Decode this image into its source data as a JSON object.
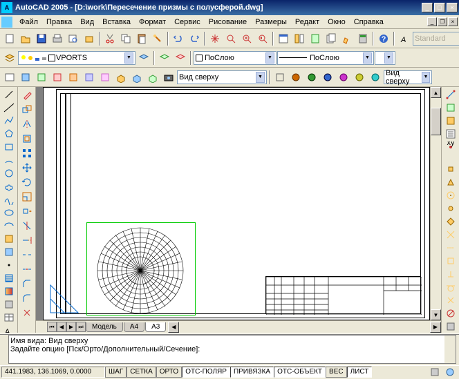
{
  "title": "AutoCAD 2005 - [D:\\work\\Пересечение призмы с полусферой.dwg]",
  "menus": [
    "Файл",
    "Правка",
    "Вид",
    "Вставка",
    "Формат",
    "Сервис",
    "Рисование",
    "Размеры",
    "Редакт",
    "Окно",
    "Справка"
  ],
  "toolbar1_combo_style": "Standard",
  "layer_name": "VPORTS",
  "layer_swatch_color": "#ffffff",
  "color_combo": "ПоСлою",
  "linetype_combo": "ПоСлою",
  "view_combo": "Вид сверху",
  "view_combo_right": "Вид сверху",
  "tabs": [
    {
      "label": "Модель",
      "active": false
    },
    {
      "label": "A4",
      "active": false
    },
    {
      "label": "A3",
      "active": true
    }
  ],
  "command_history": [
    "Имя вида: Вид сверху",
    "Задайте опцию [Пск/Орто/Дополнительный/Сечение]:"
  ],
  "status_coords": "441.1983, 136.1069, 0.0000",
  "status_buttons": [
    {
      "label": "ШАГ",
      "on": false
    },
    {
      "label": "СЕТКА",
      "on": false
    },
    {
      "label": "ОРТО",
      "on": false
    },
    {
      "label": "ОТС-ПОЛЯР",
      "on": true
    },
    {
      "label": "ПРИВЯЗКА",
      "on": true
    },
    {
      "label": "ОТС-ОБЪЕКТ",
      "on": true
    },
    {
      "label": "ВЕС",
      "on": false
    },
    {
      "label": "ЛИСТ",
      "on": true
    }
  ],
  "icons": {
    "app": "A"
  }
}
